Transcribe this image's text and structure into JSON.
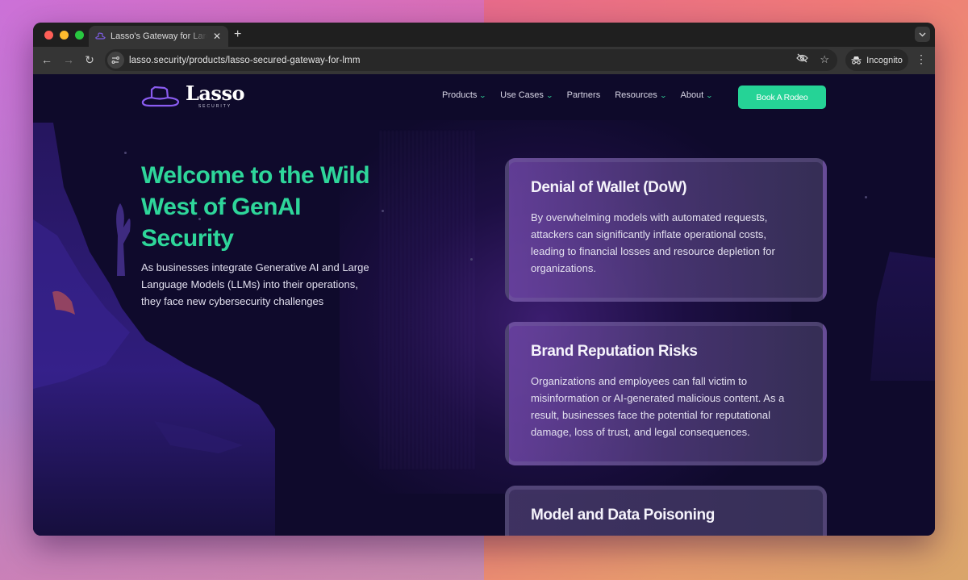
{
  "browser": {
    "tab": {
      "title": "Lasso's Gateway for Large Language Models",
      "favicon": "lasso-hat-icon"
    },
    "new_tab_label": "+",
    "address_bar": {
      "url": "lasso.security/products/lasso-secured-gateway-for-lmm"
    },
    "profile_label": "Incognito",
    "icons": {
      "back": "←",
      "forward": "→",
      "reload": "↻",
      "site_info": "⚙",
      "eye_off": "◎",
      "star": "☆",
      "incognito": "🕵",
      "menu": "⋮",
      "tab_dropdown": "⌄",
      "close": "✕"
    }
  },
  "site": {
    "logo": {
      "name": "Lasso",
      "tagline": "SECURITY"
    },
    "nav": {
      "items": [
        {
          "label": "Products",
          "has_dropdown": true
        },
        {
          "label": "Use Cases",
          "has_dropdown": true
        },
        {
          "label": "Partners",
          "has_dropdown": false
        },
        {
          "label": "Resources",
          "has_dropdown": true
        },
        {
          "label": "About",
          "has_dropdown": true
        }
      ],
      "chevron": "⌄",
      "cta_label": "Book A Rodeo"
    },
    "hero": {
      "title": "Welcome to the Wild West of GenAI Security",
      "text": "As businesses integrate Generative AI and Large Language Models (LLMs) into their operations, they face new cybersecurity challenges"
    },
    "cards": [
      {
        "title": "Denial of Wallet (DoW)",
        "body": "By overwhelming models with automated requests, attackers can significantly inflate operational costs, leading to financial losses and resource depletion for organizations."
      },
      {
        "title": "Brand Reputation Risks",
        "body": "Organizations and employees can fall victim to misinformation or AI-generated malicious content. As a result, businesses face the potential for reputational damage, loss of trust, and legal consequences."
      },
      {
        "title": "Model and Data Poisoning",
        "body": ""
      }
    ],
    "colors": {
      "accent": "#25d396",
      "background": "#0e0a2a",
      "logo_purple": "#8a5cf0"
    }
  }
}
